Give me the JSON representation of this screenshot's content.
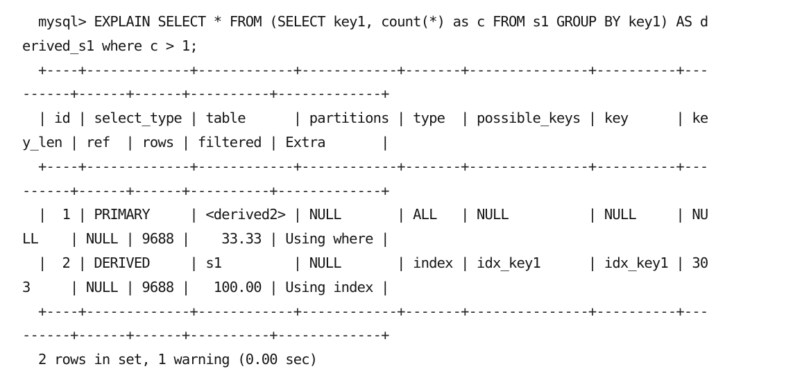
{
  "terminal": {
    "kind": "mysql-client-output",
    "prompt": "mysql>",
    "background_color": "#ffffff",
    "text_color": "#151515",
    "wrap_columns": 79,
    "query": "EXPLAIN SELECT * FROM (SELECT key1, count(*) as c FROM s1 GROUP BY key1) AS derived_s1 where c > 1;",
    "status_line": "2 rows in set, 1 warning (0.00 sec)",
    "result_table": {
      "columns": [
        "id",
        "select_type",
        "table",
        "partitions",
        "type",
        "possible_keys",
        "key",
        "key_len",
        "ref",
        "rows",
        "filtered",
        "Extra"
      ],
      "rows": [
        {
          "id": "1",
          "select_type": "PRIMARY",
          "table": "<derived2>",
          "partitions": "NULL",
          "type": "ALL",
          "possible_keys": "NULL",
          "key": "NULL",
          "key_len": "NULL",
          "ref": "NULL",
          "rows": "9688",
          "filtered": "33.33",
          "Extra": "Using where"
        },
        {
          "id": "2",
          "select_type": "DERIVED",
          "table": "s1",
          "partitions": "NULL",
          "type": "index",
          "possible_keys": "idx_key1",
          "key": "idx_key1",
          "key_len": "303",
          "ref": "NULL",
          "rows": "9688",
          "filtered": "100.00",
          "Extra": "Using index"
        }
      ],
      "row_count": 2,
      "warning_count": 1,
      "duration_sec": "0.00"
    },
    "lines": [
      "  mysql> EXPLAIN SELECT * FROM (SELECT key1, count(*) as c FROM s1 GROUP BY key1) AS d",
      "erived_s1 where c > 1;",
      "  +----+-------------+------------+------------+-------+---------------+----------+---",
      "------+------+------+----------+-------------+",
      "  | id | select_type | table      | partitions | type  | possible_keys | key      | ke",
      "y_len | ref  | rows | filtered | Extra       |",
      "  +----+-------------+------------+------------+-------+---------------+----------+---",
      "------+------+------+----------+-------------+",
      "  |  1 | PRIMARY     | <derived2> | NULL       | ALL   | NULL          | NULL     | NU",
      "LL    | NULL | 9688 |    33.33 | Using where |",
      "  |  2 | DERIVED     | s1         | NULL       | index | idx_key1      | idx_key1 | 30",
      "3     | NULL | 9688 |   100.00 | Using index |",
      "  +----+-------------+------------+------------+-------+---------------+----------+---",
      "------+------+------+----------+-------------+",
      "  2 rows in set, 1 warning (0.00 sec)"
    ]
  }
}
